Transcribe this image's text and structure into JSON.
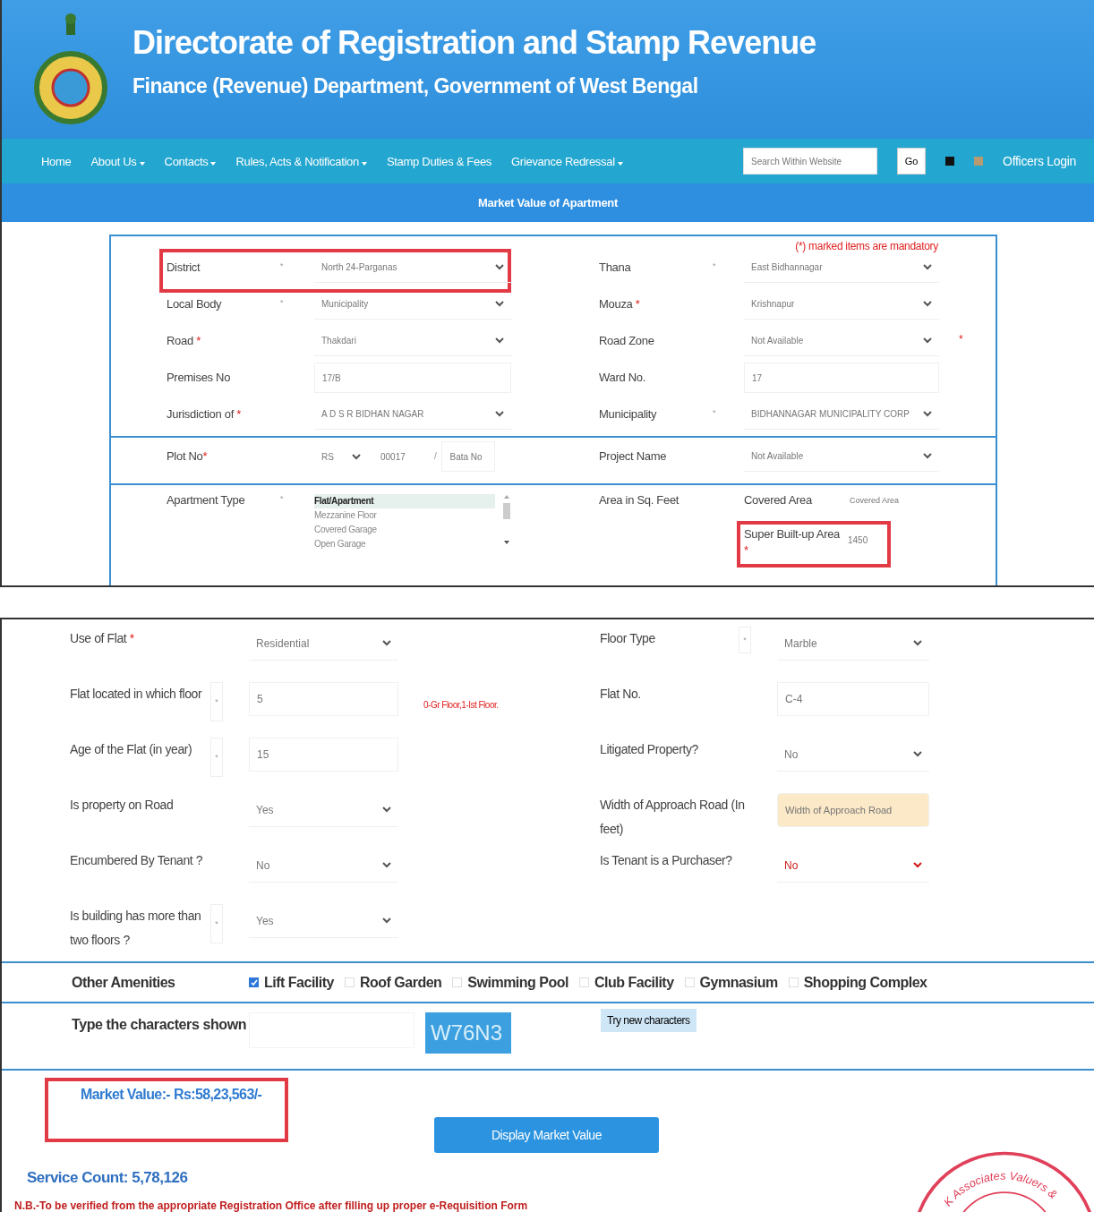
{
  "header": {
    "title": "Directorate of Registration and Stamp Revenue",
    "subtitle": "Finance (Revenue) Department, Government of West Bengal"
  },
  "nav": {
    "items": [
      {
        "label": "Home",
        "dropdown": false
      },
      {
        "label": "About Us",
        "dropdown": true
      },
      {
        "label": "Contacts",
        "dropdown": true
      },
      {
        "label": "Rules, Acts & Notification",
        "dropdown": true
      },
      {
        "label": "Stamp Duties & Fees",
        "dropdown": false
      },
      {
        "label": "Grievance Redressal",
        "dropdown": true
      }
    ],
    "search_placeholder": "Search Within Website",
    "go": "Go",
    "login": "Officers Login"
  },
  "page_title": "Market Value of Apartment",
  "form": {
    "note": "(*) marked items are mandatory",
    "rows": [
      {
        "left": {
          "label": "District",
          "side_mark": "*",
          "kind": "select",
          "value": "North 24-Parganas",
          "highlighted": true
        },
        "right": {
          "label": "Thana",
          "side_mark": "*",
          "kind": "select",
          "value": "East Bidhannagar"
        }
      },
      {
        "left": {
          "label": "Local Body",
          "side_mark": "*",
          "kind": "select",
          "value": "Municipality"
        },
        "right": {
          "label": "Mouza",
          "label_mark": "*",
          "kind": "select",
          "value": "Krishnapur"
        }
      },
      {
        "left": {
          "label": "Road",
          "label_mark": "*",
          "kind": "select",
          "value": "Thakdari"
        },
        "right": {
          "label": "Road Zone",
          "kind": "select",
          "value": "Not Available",
          "after_mark": "*"
        }
      },
      {
        "left": {
          "label": "Premises No",
          "kind": "text",
          "value": "17/B"
        },
        "right": {
          "label": "Ward No.",
          "kind": "text",
          "value": "17"
        }
      },
      {
        "left": {
          "label": "Jurisdiction of",
          "label_mark": "*",
          "kind": "select",
          "value": "A D S R  BIDHAN NAGAR"
        },
        "right": {
          "label": "Municipality",
          "side_mark": "*",
          "kind": "select",
          "value": "BIDHANNAGAR MUNICIPALITY CORP"
        }
      }
    ],
    "plot": {
      "label": "Plot No",
      "label_mark": "*",
      "prefix": "RS",
      "number": "00017",
      "separator": "/",
      "sub_placeholder": "Bata No"
    },
    "project": {
      "label": "Project Name",
      "kind": "select",
      "value": "Not Available"
    },
    "apartment": {
      "label": "Apartment Type",
      "side_mark": "*",
      "options": [
        {
          "label": "Flat/Apartment",
          "selected": true
        },
        {
          "label": "Mezzanine Floor",
          "selected": false
        },
        {
          "label": "Covered Garage",
          "selected": false
        },
        {
          "label": "Open Garage",
          "selected": false
        }
      ]
    },
    "area": {
      "label": "Area in Sq. Feet",
      "covered_label": "Covered Area",
      "covered_placeholder": "Covered Area",
      "super_label": "Super Built-up Area",
      "super_mark": "*",
      "super_value": "1450",
      "highlighted": true
    }
  },
  "details": {
    "rows": [
      {
        "left": {
          "label": "Use of Flat",
          "label_mark": "*",
          "kind": "select",
          "value": "Residential"
        },
        "right": {
          "label": "Floor Type",
          "side_mark": "*",
          "kind": "select",
          "value": "Marble"
        }
      },
      {
        "left": {
          "label": "Flat located in which floor",
          "side_mark": "*",
          "kind": "text",
          "value": "5",
          "hint": "0-Gr Floor,1-Ist Floor."
        },
        "right": {
          "label": "Flat No.",
          "kind": "text",
          "value": "C-4"
        }
      },
      {
        "left": {
          "label": "Age of the Flat (in year)",
          "side_mark": "*",
          "kind": "text",
          "value": "15"
        },
        "right": {
          "label": "Litigated Property?",
          "kind": "select",
          "value": "No"
        }
      },
      {
        "left": {
          "label": "Is property on Road",
          "kind": "select",
          "value": "Yes"
        },
        "right": {
          "label": "Width of Approach Road (In feet)",
          "kind": "text",
          "placeholder": "Width of Approach Road",
          "disabled": true
        }
      },
      {
        "left": {
          "label": "Encumbered By Tenant ?",
          "kind": "select",
          "value": "No"
        },
        "right": {
          "label": "Is Tenant is a Purchaser?",
          "kind": "select",
          "value": "No",
          "invalid": true
        }
      },
      {
        "left": {
          "label": "Is building has more than two floors ?",
          "side_mark": "*",
          "kind": "select",
          "value": "Yes"
        },
        "right": null
      }
    ],
    "amenities": {
      "label": "Other Amenities",
      "items": [
        {
          "label": "Lift Facility",
          "checked": true
        },
        {
          "label": "Roof Garden",
          "checked": false
        },
        {
          "label": "Swimming Pool",
          "checked": false
        },
        {
          "label": "Club Facility",
          "checked": false
        },
        {
          "label": "Gymnasium",
          "checked": false
        },
        {
          "label": "Shopping Complex",
          "checked": false
        }
      ]
    },
    "captcha": {
      "label": "Type the characters shown",
      "code": "W76N3",
      "refresh": "Try new characters"
    },
    "market_value": {
      "text": "Market Value:- Rs:58,23,563/-",
      "highlighted": true
    },
    "submit": "Display Market Value",
    "service_count": "Service Count: 5,78,126",
    "nb": "N.B.-To be verified from the appropriate Registration Office after filling up proper e-Requisition Form",
    "stamp": "K Associates Valuers &"
  }
}
